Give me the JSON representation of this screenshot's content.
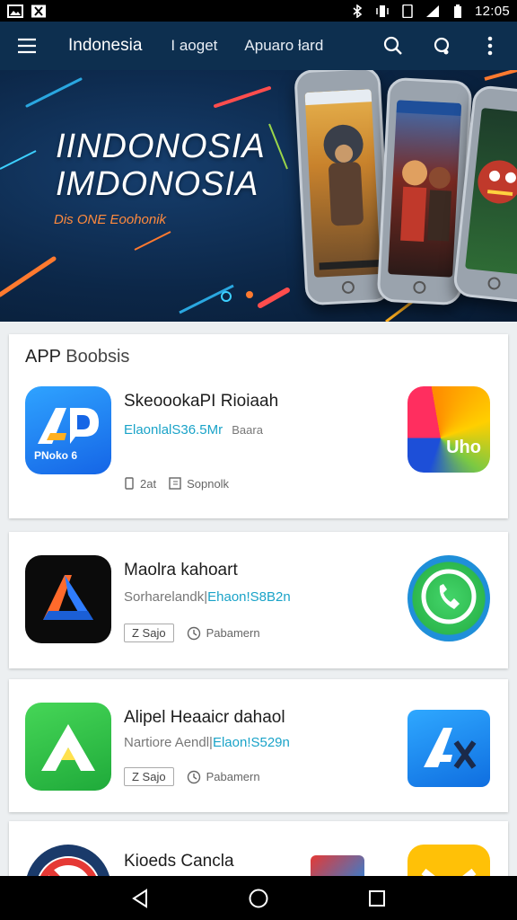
{
  "status": {
    "time": "12:05",
    "icons": [
      "image-icon",
      "x-box-icon",
      "bluetooth-icon",
      "vibrate-icon",
      "phone-icon",
      "signal-icon",
      "battery-icon"
    ]
  },
  "app_bar": {
    "title": "Indonesia",
    "tabs": [
      "I aoget",
      "Apuaro ƚard"
    ],
    "icons": [
      "menu-icon",
      "search-icon",
      "headset-icon",
      "more-vert-icon"
    ]
  },
  "banner": {
    "title_line1": "IINDONOSIA",
    "title_line2": "IMDONOSIA",
    "subtitle": "Dis ONE Eoohonik",
    "accent": "#ff8a3d"
  },
  "section": {
    "title_a": "APP",
    "title_b": "Boobsis"
  },
  "apps": [
    {
      "name": "SkeoookaPI Rioiaah",
      "price": "ElaonlalS36.5Mr",
      "price_extra": "Baara",
      "icon_label": "PNoko 6",
      "meta_a": "2at",
      "meta_b": "Sopnolk",
      "right_icon_label": "Uho"
    },
    {
      "name": "Maolra kahoart",
      "price_prefix": "Sorharelandk|",
      "price": "Ehaon!S8B2n",
      "chip_label": "Z Sajo",
      "meta_b": "Pabamern"
    },
    {
      "name": "Alipel Heaaicr dahaol",
      "price_prefix": "Nartiore Aendl|",
      "price": "Elaon!S529n",
      "chip_label": "Z Sajo",
      "meta_b": "Pabamern"
    },
    {
      "name": "Kioeds Cancla"
    }
  ],
  "colors": {
    "app_bar": "#0d2f4f",
    "price": "#1aa3c8",
    "background": "#eceff1"
  },
  "nav": {
    "icons": [
      "back-icon",
      "home-icon",
      "recents-icon"
    ]
  }
}
